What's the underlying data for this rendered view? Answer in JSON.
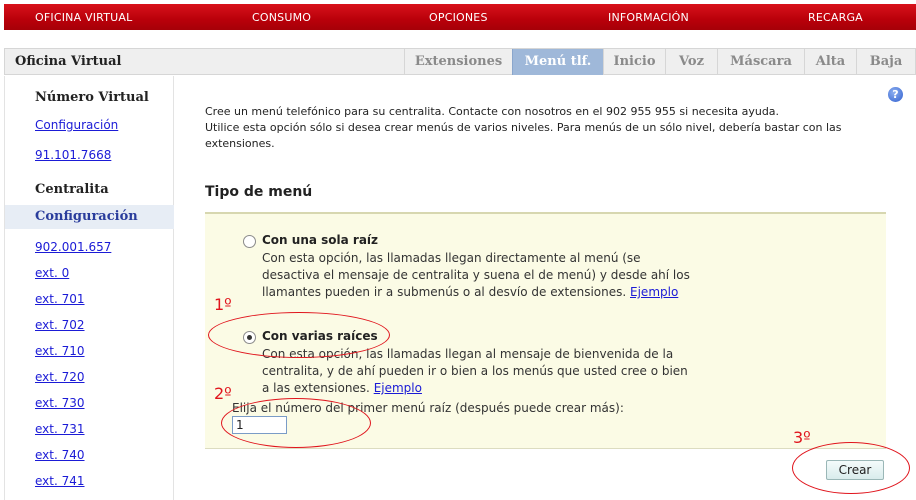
{
  "topnav": {
    "items": [
      "OFICINA VIRTUAL",
      "CONSUMO",
      "OPCIONES",
      "INFORMACIÓN",
      "RECARGA"
    ]
  },
  "titlebar": {
    "title": "Oficina Virtual",
    "tabs": [
      "Extensiones",
      "Menú tlf.",
      "Inicio",
      "Voz",
      "Máscara",
      "Alta",
      "Baja"
    ],
    "active_tab": "Menú tlf."
  },
  "sidebar": {
    "section1_title": "Número Virtual",
    "section1_links": [
      "Configuración",
      "91.101.7668"
    ],
    "section2_title": "Centralita",
    "selected_item": "Configuración",
    "section2_links": [
      "902.001.657",
      "ext. 0",
      "ext. 701",
      "ext. 702",
      "ext. 710",
      "ext. 720",
      "ext. 730",
      "ext. 731",
      "ext. 740",
      "ext. 741"
    ]
  },
  "main": {
    "help_icon": "?",
    "intro_line1": "Cree un menú telefónico para su centralita. Contacte con nosotros en el 902 955 955 si necesita ayuda.",
    "intro_line2": "Utilice esta opción sólo si desea crear menús de varios niveles. Para menús de un sólo nivel, debería bastar con las extensiones.",
    "section_title": "Tipo de menú",
    "option1": {
      "title": "Con una sola raíz",
      "desc": "Con esta opción, las llamadas llegan directamente al menú (se desactiva el mensaje de centralita y suena el de menú) y desde ahí los llamantes pueden ir a submenús o al desvío de extensiones.",
      "link": "Ejemplo",
      "checked": false
    },
    "option2": {
      "title": "Con varias raíces",
      "desc": "Con esta opción, las llamadas llegan al mensaje de bienvenida de la centralita, y de ahí pueden ir o bien a los menús que usted cree o bien a las extensiones.",
      "link": "Ejemplo",
      "checked": true
    },
    "field_label": "Elija el número del primer menú raíz (después puede crear más):",
    "field_value": "1",
    "create_button": "Crear"
  },
  "annotations": [
    "1º",
    "2º",
    "3º"
  ],
  "colors": {
    "topnav_red": "#b9000a",
    "active_tab": "#9fb8d9",
    "link_blue": "#1b1bd6",
    "panel_bg": "#fbfbe5",
    "annotation_red": "#e0151d"
  }
}
